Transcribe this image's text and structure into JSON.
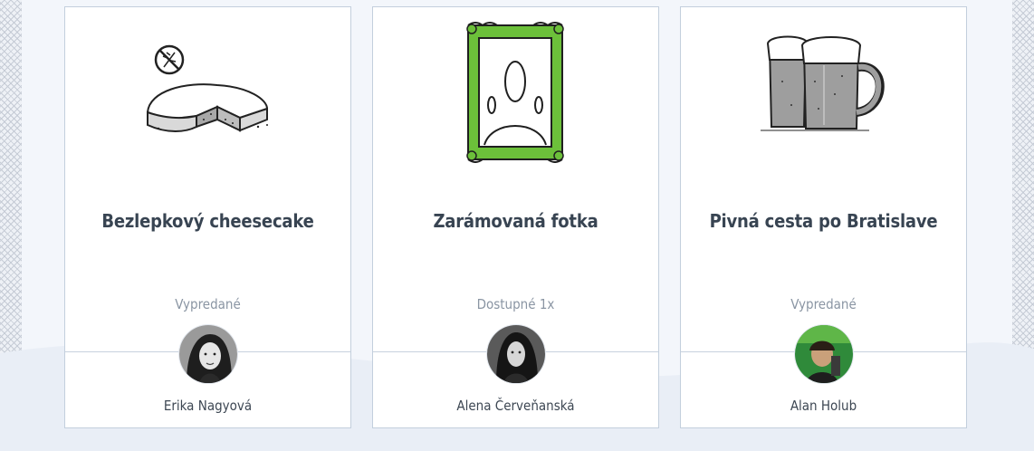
{
  "cards": [
    {
      "icon": "gluten-free-cheesecake-icon",
      "title": "Bezlepkový cheesecake",
      "status": "Vypredané",
      "author": "Erika Nagyová"
    },
    {
      "icon": "picture-frame-icon",
      "title": "Zarámovaná fotka",
      "status": "Dostupné 1x",
      "author": "Alena Červeňanská"
    },
    {
      "icon": "beer-mugs-icon",
      "title": "Pivná cesta po Bratislave",
      "status": "Vypredané",
      "author": "Alan Holub"
    }
  ],
  "colors": {
    "title": "#384452",
    "status": "#8a95a3",
    "frame_green": "#6cc03a",
    "card_border": "#c3cfdd"
  }
}
